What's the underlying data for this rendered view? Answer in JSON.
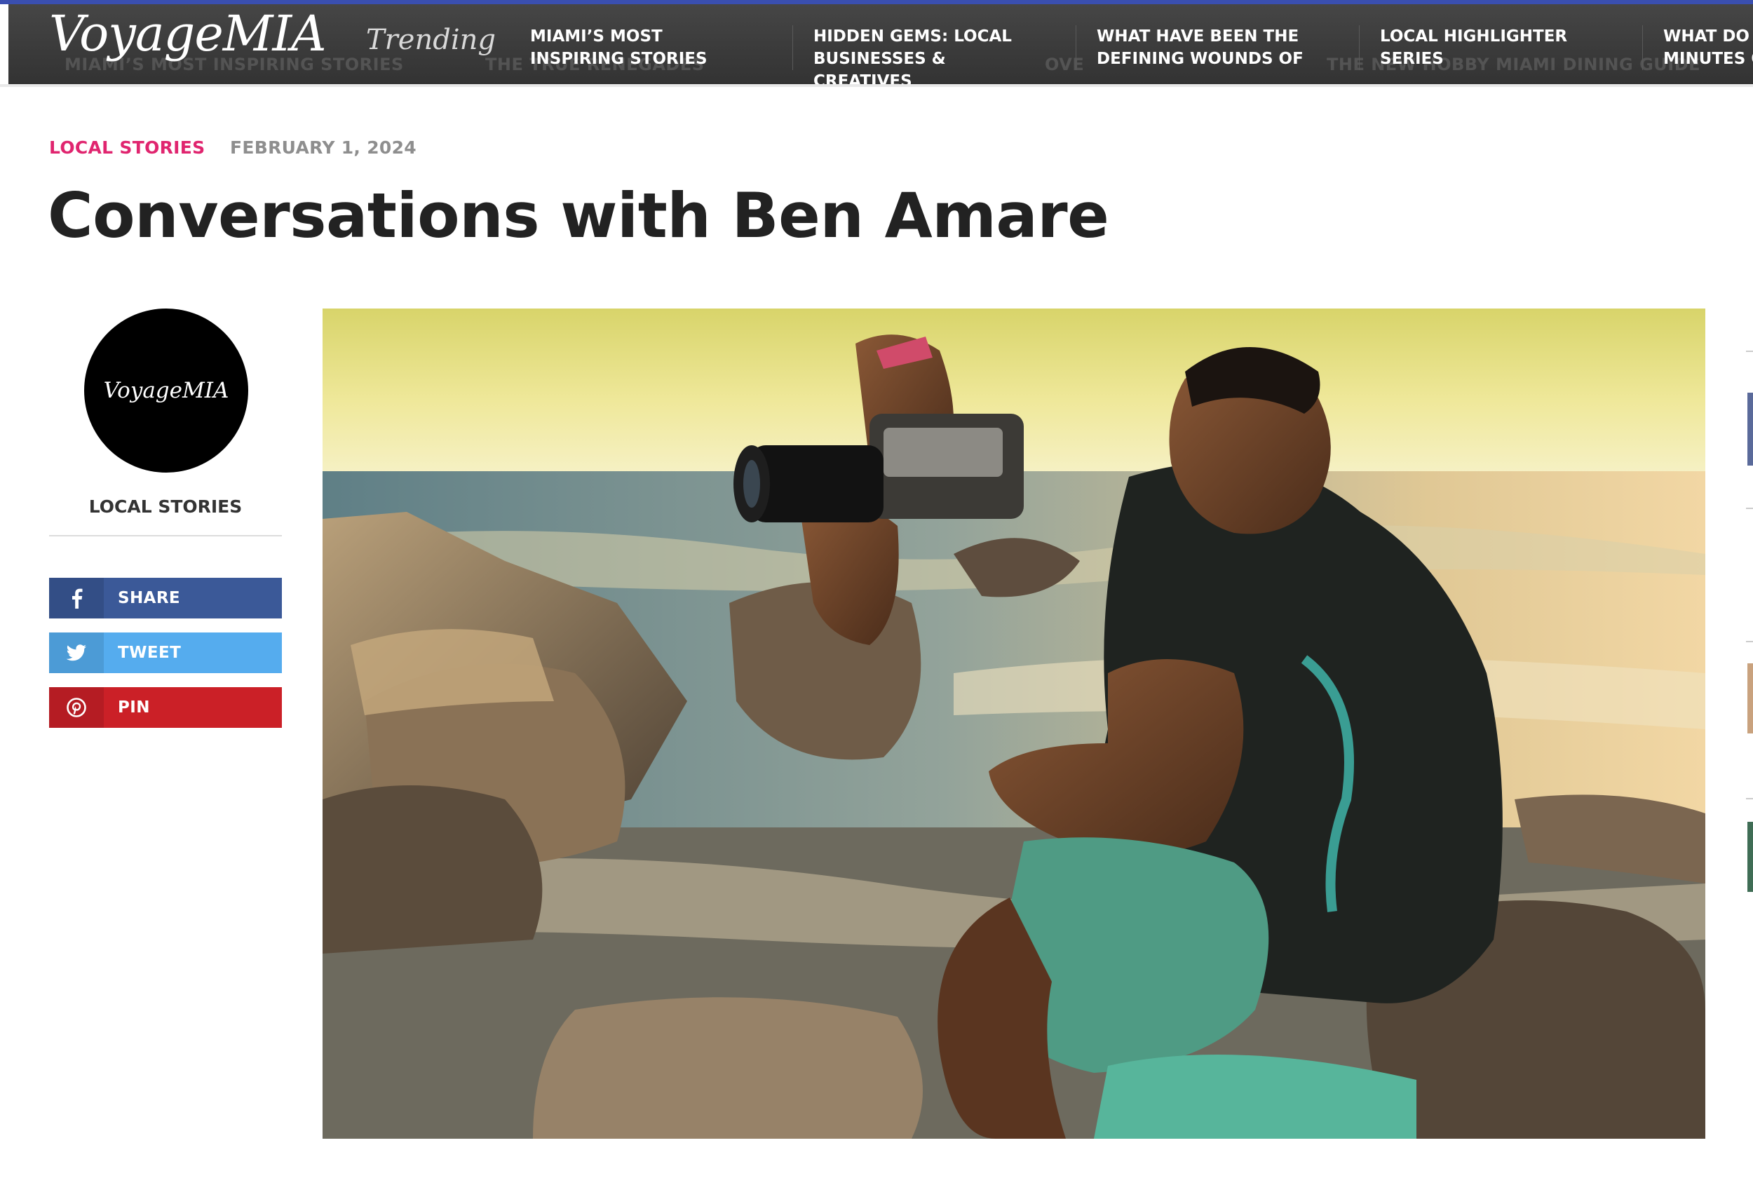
{
  "site": {
    "logo": "VoyageMIA",
    "trending_label": "Trending"
  },
  "trending": [
    {
      "label": "MIAMI’S MOST INSPIRING STORIES"
    },
    {
      "label": "HIDDEN GEMS: LOCAL BUSINESSES & CREATIVES"
    },
    {
      "label": "WHAT HAVE BEEN THE DEFINING WOUNDS OF"
    },
    {
      "label": "LOCAL HIGHLIGHTER SERIES"
    },
    {
      "label": "WHAT DO MINUTES O"
    }
  ],
  "ticker_background": [
    "MIAMI’S MOST INSPIRING STORIES",
    "THE TRUE RENEGADES",
    "OVE",
    "THE NEW HOBBY MIAMI DINING GUIDE"
  ],
  "article": {
    "category": "LOCAL STORIES",
    "date": "FEBRUARY 1, 2024",
    "title": "Conversations with Ben Amare"
  },
  "author": {
    "avatar_text": "VoyageMIA",
    "category": "LOCAL STORIES"
  },
  "share": {
    "facebook": {
      "label": "SHARE",
      "icon": "facebook-icon",
      "color": "#3b5998"
    },
    "twitter": {
      "label": "TWEET",
      "icon": "twitter-icon",
      "color": "#55acee"
    },
    "pinterest": {
      "label": "PIN",
      "icon": "pinterest-icon",
      "color": "#cb2027"
    }
  },
  "colors": {
    "accent_pink": "#e0256f",
    "topbar": "#3b3b3b",
    "title": "#222222"
  }
}
